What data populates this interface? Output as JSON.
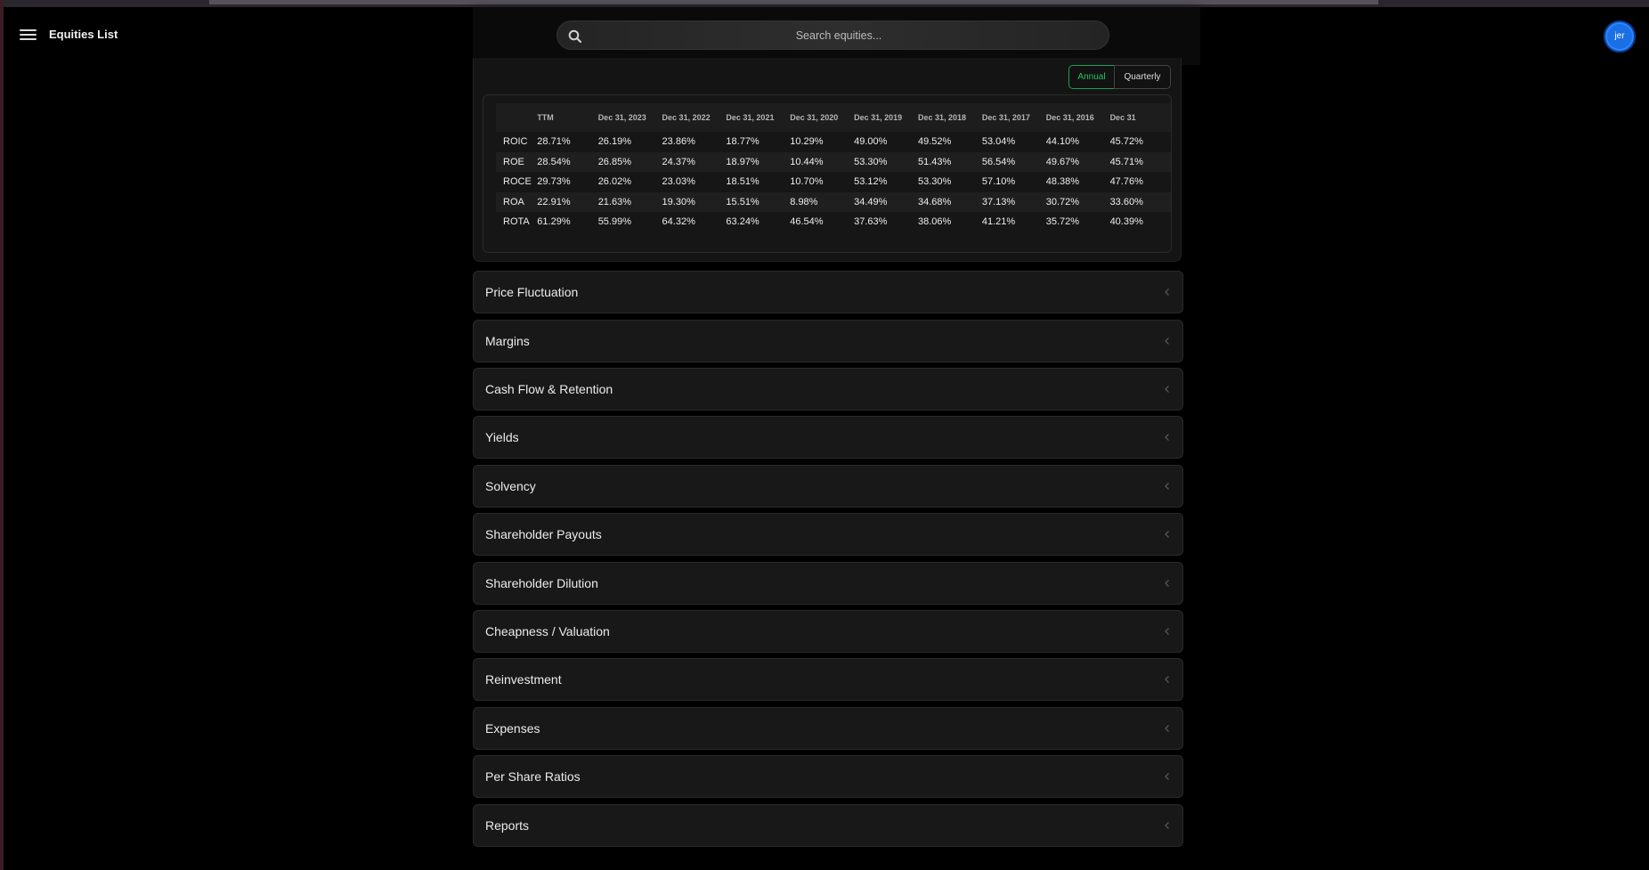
{
  "header": {
    "title": "Equities List",
    "search_placeholder": "Search equities...",
    "avatar_initials": "jer",
    "avatar_color": "#1b6fe4"
  },
  "returns_panel": {
    "toggle": {
      "annual": "Annual",
      "quarterly": "Quarterly",
      "selected": "Annual",
      "accent": "#22c55e"
    },
    "columns": [
      "",
      "TTM",
      "Dec 31, 2023",
      "Dec 31, 2022",
      "Dec 31, 2021",
      "Dec 31, 2020",
      "Dec 31, 2019",
      "Dec 31, 2018",
      "Dec 31, 2017",
      "Dec 31, 2016",
      "Dec 31"
    ],
    "rows": [
      {
        "metric": "ROIC",
        "values": [
          "28.71%",
          "26.19%",
          "23.86%",
          "18.77%",
          "10.29%",
          "49.00%",
          "49.52%",
          "53.04%",
          "44.10%",
          "45.72%"
        ]
      },
      {
        "metric": "ROE",
        "values": [
          "28.54%",
          "26.85%",
          "24.37%",
          "18.97%",
          "10.44%",
          "53.30%",
          "51.43%",
          "56.54%",
          "49.67%",
          "45.71%"
        ]
      },
      {
        "metric": "ROCE",
        "values": [
          "29.73%",
          "26.02%",
          "23.03%",
          "18.51%",
          "10.70%",
          "53.12%",
          "53.30%",
          "57.10%",
          "48.38%",
          "47.76%"
        ]
      },
      {
        "metric": "ROA",
        "values": [
          "22.91%",
          "21.63%",
          "19.30%",
          "15.51%",
          "8.98%",
          "34.49%",
          "34.68%",
          "37.13%",
          "30.72%",
          "33.60%"
        ]
      },
      {
        "metric": "ROTA",
        "values": [
          "61.29%",
          "55.99%",
          "64.32%",
          "63.24%",
          "46.54%",
          "37.63%",
          "38.06%",
          "41.21%",
          "35.72%",
          "40.39%"
        ]
      }
    ]
  },
  "sections": [
    "Price Fluctuation",
    "Margins",
    "Cash Flow & Retention",
    "Yields",
    "Solvency",
    "Shareholder Payouts",
    "Shareholder Dilution",
    "Cheapness / Valuation",
    "Reinvestment",
    "Expenses",
    "Per Share Ratios",
    "Reports"
  ]
}
